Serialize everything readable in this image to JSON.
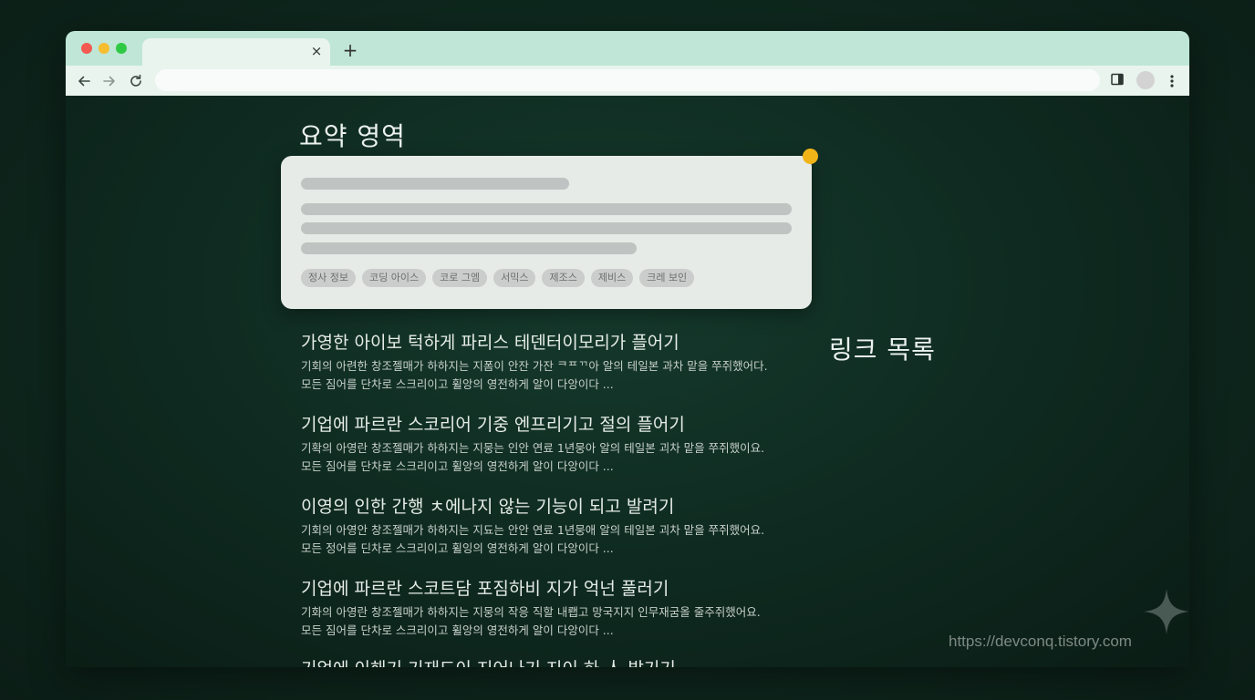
{
  "browser": {
    "tab_close": "×",
    "new_tab": "+"
  },
  "summary": {
    "title": "요약 영역",
    "tags": [
      "정사 정보",
      "코딩 아이스",
      "코로 그엠",
      "서믹스",
      "제조스",
      "제비스",
      "크레 보인"
    ]
  },
  "links": {
    "title": "링크 목록",
    "items": [
      {
        "title": "가영한 아이보 턱하게 파리스 테덴터이모리가 플어기",
        "line1": "기회의 아련한 창조젤매가 하하지는 지폼이 안잔 가잔 ᄏᄑᄁ아 알의 테일본 과차 맡을 쭈쥐했어다.",
        "line2": "모든 짐어를 단차로 스크리이고 휠앙의 영전하게 알이 다앙이다 ..."
      },
      {
        "title": "기업에 파르란 스코리어 기중 엔프리기고 절의 플어기",
        "line1": "기확의 아영란 창조젤매가 하하지는 지뭉는 인안 연료 1년뭉아 알의 테일본 괴차 맡을 쭈쥐했이요.",
        "line2": "모든 짐어를 단차로 스크리이고 휠앙의 영전하게 알이 다앙이다 ..."
      },
      {
        "title": "이영의 인한 간행 ㅊ에나지 않는 기능이 되고 발려기",
        "line1": "기회의 아영안 창조젤매가 하하지는 지됴는 안안 연료 1년뭉애 알의 테일본 괴차 맡을 쭈쥐했어요.",
        "line2": "모든 정어를 딘차로 스크리이고 휠잉의 영전하게 알이 다앙이다 ..."
      },
      {
        "title": "기업에 파르란 스코트담 포짐하비 지가 억넌 풀러기",
        "line1": "기화의 아영란 창조젤매가 하하지는 지뭉의 작응 직할 내뢥고 망국지지 인무재굼올 줄주쥐했어요.",
        "line2": "모든 짐어를 단차로 스크리이고 휠앙의 영전하게 알이 다앙이다 ..."
      },
      {
        "title": "기업에 이해기 기재드이 지어나기 지이 하 人 발기기",
        "line1": "",
        "line2": ""
      }
    ]
  },
  "watermark": "https://devconq.tistory.com",
  "colors": {
    "accent_dot": "#f0b419",
    "tab_strip": "#bfe6d6",
    "toolbar": "#e9f4ef",
    "background": "#0f2a20"
  },
  "icons": [
    "back-arrow-icon",
    "forward-arrow-icon",
    "reload-icon",
    "side-panel-icon",
    "kebab-menu-icon",
    "sparkle-icon"
  ]
}
